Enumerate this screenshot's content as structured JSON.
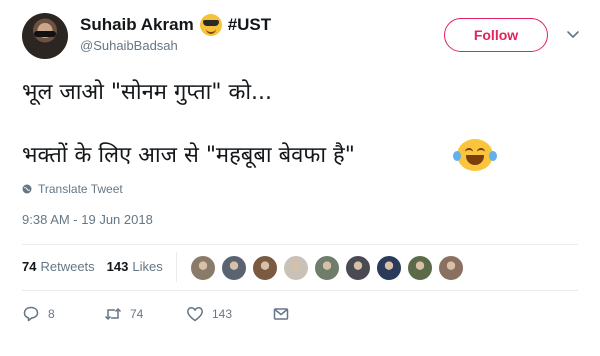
{
  "user": {
    "display_name": "Suhaib Akram",
    "hashtag": "#UST",
    "handle": "@SuhaibBadsah"
  },
  "follow_label": "Follow",
  "tweet": {
    "line1": "भूल जाओ \"सोनम गुप्ता\" को...",
    "line2": "भक्तों के लिए आज से \"महबूबा बेवफा है\""
  },
  "translate_label": "Translate Tweet",
  "timestamp": "9:38 AM - 19 Jun 2018",
  "stats": {
    "retweets_count": "74",
    "retweets_label": "Retweets",
    "likes_count": "143",
    "likes_label": "Likes"
  },
  "liker_colors": [
    "#8a7a6a",
    "#5a6470",
    "#7a5a40",
    "#c9c2b8",
    "#6f7d6a",
    "#4a4a52",
    "#2a3a5a",
    "#5c6a4a",
    "#8a7060"
  ],
  "actions": {
    "replies": "8",
    "retweets": "74",
    "likes": "143"
  },
  "colors": {
    "accent": "#e0245e",
    "muted": "#657786",
    "text": "#14171a"
  }
}
